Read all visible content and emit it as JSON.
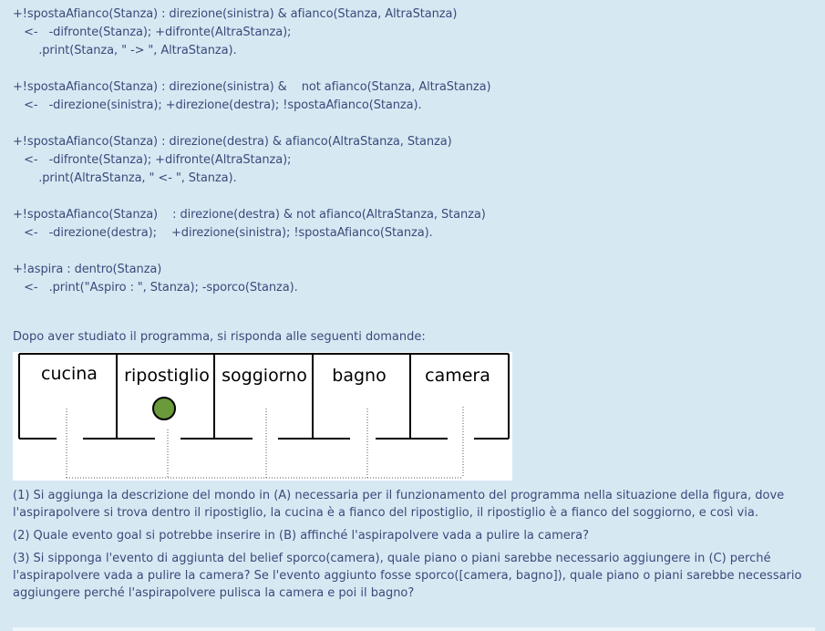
{
  "code_lines": [
    "+!spostaAfianco(Stanza) : direzione(sinistra) & afianco(Stanza, AltraStanza)",
    "   <-   -difronte(Stanza); +difronte(AltraStanza);",
    "       .print(Stanza, \" -> \", AltraStanza).",
    "",
    "+!spostaAfianco(Stanza) : direzione(sinistra) &    not afianco(Stanza, AltraStanza)",
    "   <-   -direzione(sinistra); +direzione(destra); !spostaAfianco(Stanza).",
    "",
    "+!spostaAfianco(Stanza) : direzione(destra) & afianco(AltraStanza, Stanza)",
    "   <-   -difronte(Stanza); +difronte(AltraStanza);",
    "       .print(AltraStanza, \" <- \", Stanza).",
    "",
    "+!spostaAfianco(Stanza)    : direzione(destra) & not afianco(AltraStanza, Stanza)",
    "   <-   -direzione(destra);    +direzione(sinistra); !spostaAfianco(Stanza).",
    "",
    "+!aspira : dentro(Stanza)",
    "   <-   .print(\"Aspiro : \", Stanza); -sporco(Stanza)."
  ],
  "intro": "Dopo aver studiato il programma, si risponda alle seguenti domande:",
  "rooms": [
    "cucina",
    "ripostiglio",
    "soggiorno",
    "bagno",
    "camera"
  ],
  "questions": [
    "(1) Si aggiunga la descrizione del mondo in (A) necessaria per il funzionamento del programma nella situazione della figura, dove l'aspirapolvere si trova dentro il ripostiglio, la cucina è a fianco del ripostiglio, il ripostiglio è a fianco del soggiorno, e così via.",
    "(2) Quale evento goal si potrebbe inserire in (B) affinché l'aspirapolvere vada a pulire la camera?",
    "(3) Si sipponga l'evento di aggiunta del belief sporco(camera), quale piano o piani sarebbe necessario aggiungere in (C) perché l'aspirapolvere vada a pulire la camera? Se l'evento aggiunto fosse sporco([camera, bagno]), quale piano o piani sarebbe necessario aggiungere perché l'aspirapolvere pulisca la camera e poi il bagno?"
  ],
  "colors": {
    "background": "#d6e9f3",
    "text": "#3a4a7a",
    "vacuum": "#6a9a3a"
  }
}
